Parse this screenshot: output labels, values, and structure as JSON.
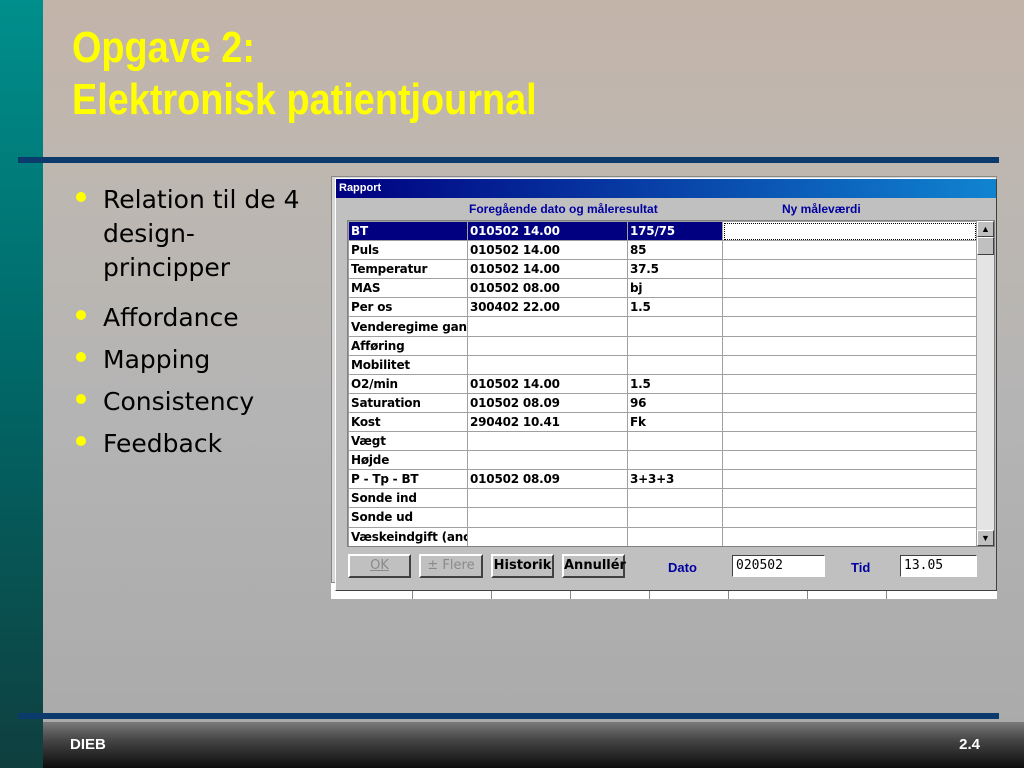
{
  "slide": {
    "title_line1": "Opgave 2:",
    "title_line2": "Elektronisk patientjournal",
    "bullets": [
      "Relation til de 4 design-principper",
      "Affordance",
      "Mapping",
      "Consistency",
      "Feedback"
    ],
    "footer_left": "DIEB",
    "footer_right": "2.4",
    "accent_color": "#ffff00",
    "rule_color": "#0b3a6c"
  },
  "dialog": {
    "title": "Rapport",
    "col_header_prev": "Foregående dato og måleresultat",
    "col_header_new": "Ny måleværdi",
    "rows": [
      {
        "name": "BT",
        "date": "010502 14.00",
        "value": "175/75",
        "new": "",
        "selected": true
      },
      {
        "name": "Puls",
        "date": "010502 14.00",
        "value": "85",
        "new": ""
      },
      {
        "name": "Temperatur",
        "date": "010502 14.00",
        "value": "37.5",
        "new": ""
      },
      {
        "name": "MAS",
        "date": "010502 08.00",
        "value": "bj",
        "new": ""
      },
      {
        "name": "Per os",
        "date": "300402 22.00",
        "value": "1.5",
        "new": ""
      },
      {
        "name": "Venderegime gan",
        "date": "",
        "value": "",
        "new": ""
      },
      {
        "name": "Afføring",
        "date": "",
        "value": "",
        "new": ""
      },
      {
        "name": "Mobilitet",
        "date": "",
        "value": "",
        "new": ""
      },
      {
        "name": "O2/min",
        "date": "010502 14.00",
        "value": "1.5",
        "new": ""
      },
      {
        "name": "Saturation",
        "date": "010502 08.09",
        "value": "96",
        "new": ""
      },
      {
        "name": "Kost",
        "date": "290402 10.41",
        "value": "Fk",
        "new": ""
      },
      {
        "name": "Vægt",
        "date": "",
        "value": "",
        "new": ""
      },
      {
        "name": "Højde",
        "date": "",
        "value": "",
        "new": ""
      },
      {
        "name": "P - Tp - BT",
        "date": "010502 08.09",
        "value": "3+3+3",
        "new": ""
      },
      {
        "name": "Sonde ind",
        "date": "",
        "value": "",
        "new": ""
      },
      {
        "name": "Sonde ud",
        "date": "",
        "value": "",
        "new": ""
      },
      {
        "name": "Væskeindgift (anc",
        "date": "",
        "value": "",
        "new": ""
      }
    ],
    "buttons": {
      "ok": "OK",
      "flere": "± Flere",
      "historik": "Historik",
      "annuller": "Annullér"
    },
    "dato_label": "Dato",
    "dato_value": "020502",
    "tid_label": "Tid",
    "tid_value": "13.05",
    "scroll_up": "▲",
    "scroll_down": "▼"
  }
}
